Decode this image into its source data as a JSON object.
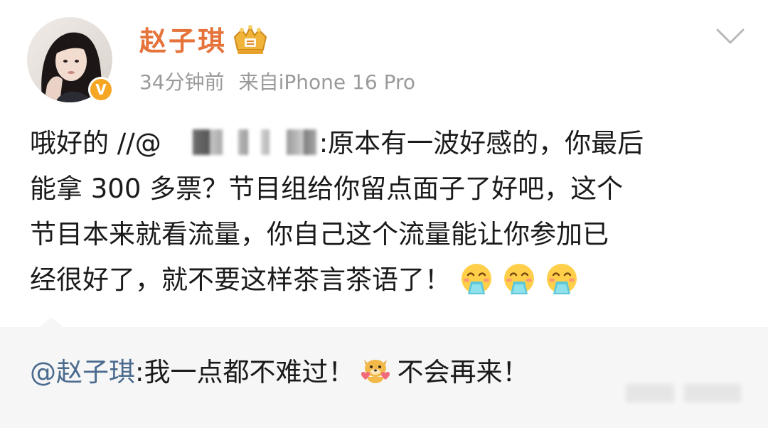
{
  "post": {
    "author": {
      "name": "赵子琪",
      "avatar": "avatar-photo",
      "verified_badge": "V",
      "crown_icon": "vip-crown-icon"
    },
    "meta": {
      "time": "34分钟前",
      "source": "来自iPhone 16 Pro"
    },
    "content": {
      "line1_prefix": "哦好的 //@",
      "line1_suffix": ":原本有一波好感的，你最后",
      "line2": "能拿 300 多票？节目组给你留点面子了好吧，这个",
      "line3": "节目本来就看流量，你自己这个流量能让你参加已",
      "line4": "经很好了，就不要这样茶言茶语了！",
      "emojis": [
        "vomit-emoji",
        "vomit-emoji",
        "vomit-emoji"
      ]
    },
    "reply": {
      "mention": "@赵子琪",
      "text_before": ":我一点都不难过！",
      "sticker": "dog-sticker-icon",
      "text_after": "不会再来！"
    },
    "colors": {
      "name": "#e5733a",
      "meta": "#9a9a9a",
      "text": "#1a1a1a",
      "mention": "#4a6b8e",
      "reply_background": "#f6f6f6",
      "badge": "#f5a623"
    }
  }
}
